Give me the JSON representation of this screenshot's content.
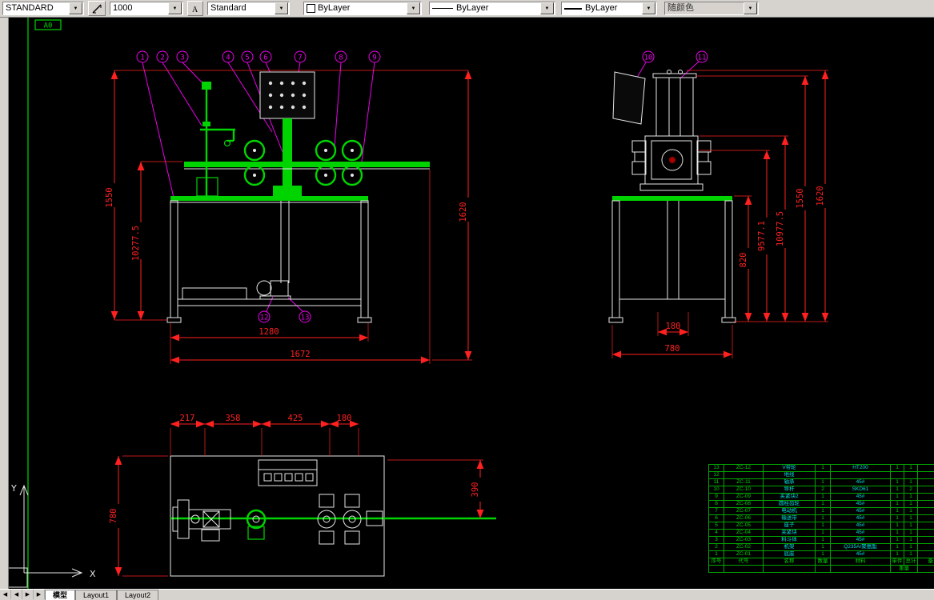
{
  "toolbar": {
    "dimstyle": "STANDARD",
    "scale": "1000",
    "textstyle": "Standard",
    "color": "ByLayer",
    "linetype": "ByLayer",
    "lineweight": "ByLayer",
    "plotstyle": "随颜色"
  },
  "icons": {
    "dropdown_arrow": "▼",
    "nav_first": "◀",
    "nav_prev": "◀",
    "nav_next": "▶",
    "nav_last": "▶"
  },
  "sheet": {
    "label": "A0"
  },
  "axes": {
    "x": "X",
    "y": "Y"
  },
  "balloons": {
    "front_top": [
      "1",
      "2",
      "3",
      "4",
      "5",
      "6",
      "7",
      "8",
      "9"
    ],
    "front_bottom": [
      "12",
      "13"
    ],
    "side_top": [
      "10",
      "11"
    ]
  },
  "front_view": {
    "dims": {
      "h1550": "1550",
      "h10277": "10277.5",
      "h1620": "1620",
      "w1280": "1280",
      "w1672": "1672"
    }
  },
  "side_view": {
    "dims": {
      "v820": "820",
      "v9577": "9577.1",
      "v10977": "10977.5",
      "v1550": "1550",
      "v1620": "1620",
      "w180": "180",
      "w780": "780"
    }
  },
  "top_view": {
    "dims": {
      "d217": "217",
      "d358": "358",
      "d425": "425",
      "d180": "180",
      "h780": "780",
      "h390": "390"
    }
  },
  "parts_table": {
    "rows": [
      [
        "13",
        "ZC-12",
        "V带轮",
        "1",
        "HT200",
        "1",
        "1",
        ""
      ],
      [
        "12",
        "",
        "地线",
        "",
        "",
        "",
        "",
        ""
      ],
      [
        "11",
        "ZC-11",
        "轴承",
        "1",
        "45#",
        "1",
        "1",
        ""
      ],
      [
        "10",
        "ZC-10",
        "导杆",
        "2",
        "SKD61",
        "1",
        "2",
        ""
      ],
      [
        "9",
        "ZC-09",
        "夹紧块2",
        "1",
        "45#",
        "1",
        "1",
        ""
      ],
      [
        "8",
        "ZC-08",
        "圆柱齿轮",
        "1",
        "45#",
        "1",
        "1",
        ""
      ],
      [
        "7",
        "ZC-07",
        "电动机",
        "1",
        "45#",
        "1",
        "1",
        ""
      ],
      [
        "6",
        "ZC-06",
        "输送带",
        "1",
        "45#",
        "1",
        "1",
        ""
      ],
      [
        "5",
        "ZC-05",
        "座子",
        "1",
        "45#",
        "1",
        "1",
        ""
      ],
      [
        "4",
        "ZC-04",
        "夹紧块",
        "1",
        "45#",
        "1",
        "1",
        ""
      ],
      [
        "3",
        "ZC-03",
        "料斗体",
        "1",
        "45#",
        "1",
        "1",
        ""
      ],
      [
        "2",
        "ZC-02",
        "机架",
        "1",
        "Q235A/聚氨酯",
        "1",
        "1",
        ""
      ],
      [
        "1",
        "ZC-01",
        "底座",
        "1",
        "45#",
        "1",
        "1",
        ""
      ]
    ],
    "header": [
      "序号",
      "代号",
      "名称",
      "数量",
      "材料",
      "单件",
      "总计",
      "备注"
    ],
    "weight_label": "重量"
  },
  "tabs": {
    "model": "模型",
    "layout1": "Layout1",
    "layout2": "Layout2"
  }
}
